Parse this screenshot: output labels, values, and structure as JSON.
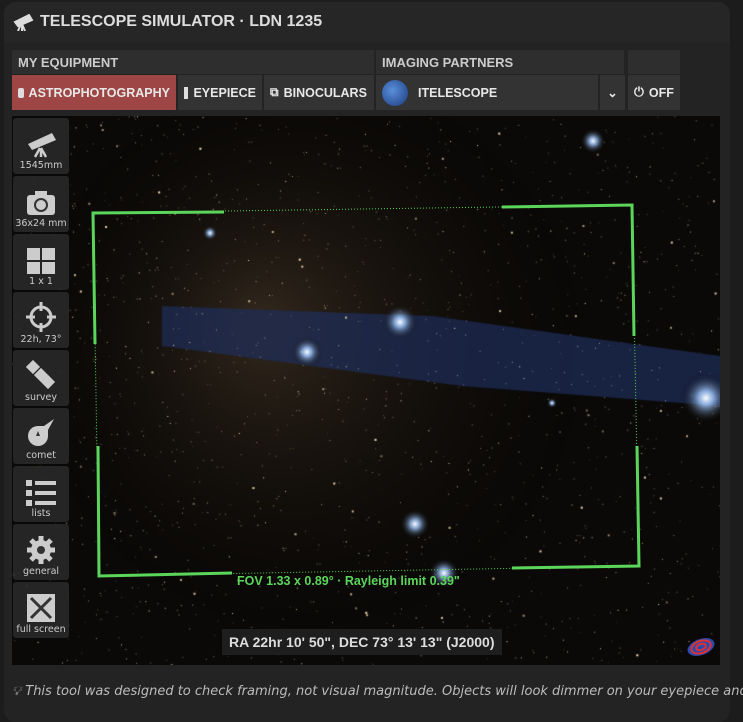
{
  "header": {
    "title": "TELESCOPE SIMULATOR · LDN 1235"
  },
  "equipment": {
    "label": "MY EQUIPMENT",
    "buttons": [
      "ASTROPHOTOGRAPHY",
      "EYEPIECE",
      "BINOCULARS"
    ]
  },
  "partners": {
    "label": "IMAGING PARTNERS",
    "selected": "ITELESCOPE",
    "off_label": "OFF"
  },
  "sidebar": [
    "1545mm",
    "36x24 mm",
    "1 x 1",
    "22h, 73°",
    "survey",
    "comet",
    "lists",
    "general",
    "full screen"
  ],
  "viewer": {
    "fov_text": "FOV 1.33 x 0.89° · Rayleigh limit 0.39\"",
    "coords": "RA 22hr 10' 50\", DEC 73° 13' 13\" (J2000)"
  },
  "note": "This tool was designed to check framing, not visual magnitude. Objects will look dimmer on your eyepiece and",
  "colors": {
    "accent": "#9e4646",
    "fov": "#5bd65b"
  }
}
